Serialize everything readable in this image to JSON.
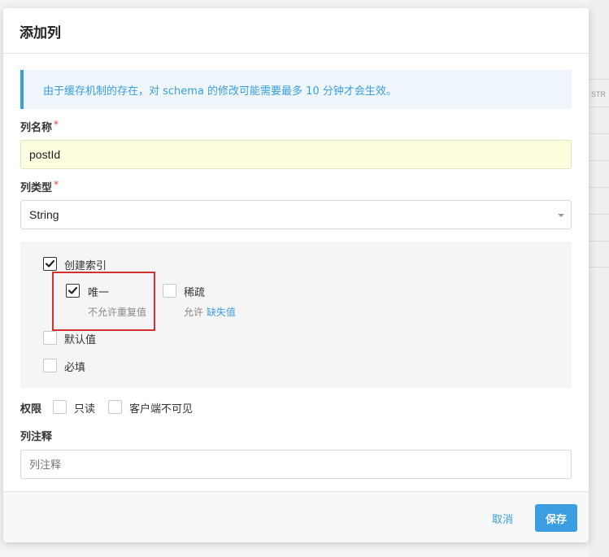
{
  "background": {
    "right_column_label": "STR"
  },
  "modal": {
    "title": "添加列",
    "info_prefix": "由于缓存机制的存在，对 schema 的修改可能需要最多 10 分钟才会生效。",
    "column_name": {
      "label": "列名称",
      "required_mark": "*",
      "value": "postId"
    },
    "column_type": {
      "label": "列类型",
      "required_mark": "*",
      "selected": "String"
    },
    "options": {
      "create_index": {
        "label": "创建索引",
        "checked": true
      },
      "unique": {
        "label": "唯一",
        "checked": true,
        "description": "不允许重复值"
      },
      "sparse": {
        "label": "稀疏",
        "checked": false,
        "description_prefix": "允许",
        "description_link": "缺失值"
      },
      "default_value": {
        "label": "默认值",
        "checked": false
      },
      "required": {
        "label": "必填",
        "checked": false
      }
    },
    "permissions": {
      "label": "权限",
      "readonly": {
        "label": "只读",
        "checked": false
      },
      "client_hidden": {
        "label": "客户端不可见",
        "checked": false
      }
    },
    "comment": {
      "label": "列注释",
      "placeholder": "列注释"
    },
    "footer": {
      "cancel_label": "取消",
      "save_label": "保存"
    }
  },
  "colors": {
    "accent": "#3a9ee0",
    "highlight": "#d62f2f",
    "required": "#e04040"
  }
}
